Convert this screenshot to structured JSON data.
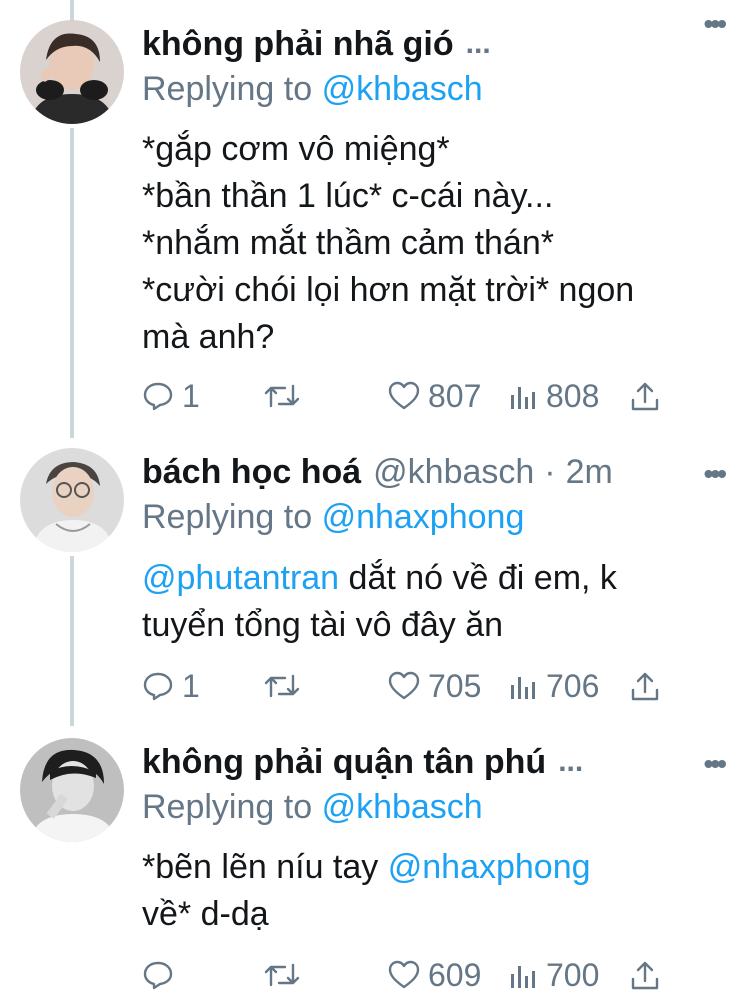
{
  "tweets": [
    {
      "name": "không phải nhã gió",
      "ellipsis": "...",
      "handle": "",
      "time": "",
      "replying_prefix": "Replying to",
      "replying_to": "@khbasch",
      "body_lines": [
        "*gắp cơm vô miệng*",
        "*bần thần 1 lúc* c-cái này...",
        "*nhắm mắt thầm cảm thán*",
        "*cười chói lọi hơn mặt trời* ngon",
        "mà anh?"
      ],
      "replies": "1",
      "likes": "807",
      "views": "808"
    },
    {
      "name": "bách học hoá",
      "handle": "@khbasch",
      "separator": "·",
      "time": "2m",
      "replying_prefix": "Replying to",
      "replying_to": "@nhaxphong",
      "body_mention": "@phutantran",
      "body_line1_rest": " dắt nó về đi em, k",
      "body_line2": "tuyển tổng tài vô đây ăn",
      "replies": "1",
      "likes": "705",
      "views": "706"
    },
    {
      "name": "không phải quận tân phú",
      "ellipsis": "...",
      "replying_prefix": "Replying to",
      "replying_to": "@khbasch",
      "body_line1_start": "*bẽn lẽn níu tay ",
      "body_mention": "@nhaxphong",
      "body_line2": "về* d-dạ",
      "replies": "",
      "likes": "609",
      "views": "700"
    }
  ],
  "more_label": "•••",
  "colors": {
    "link": "#1da1f2",
    "muted": "#657786",
    "text": "#14171a",
    "thread_line": "#ccd6dd"
  }
}
